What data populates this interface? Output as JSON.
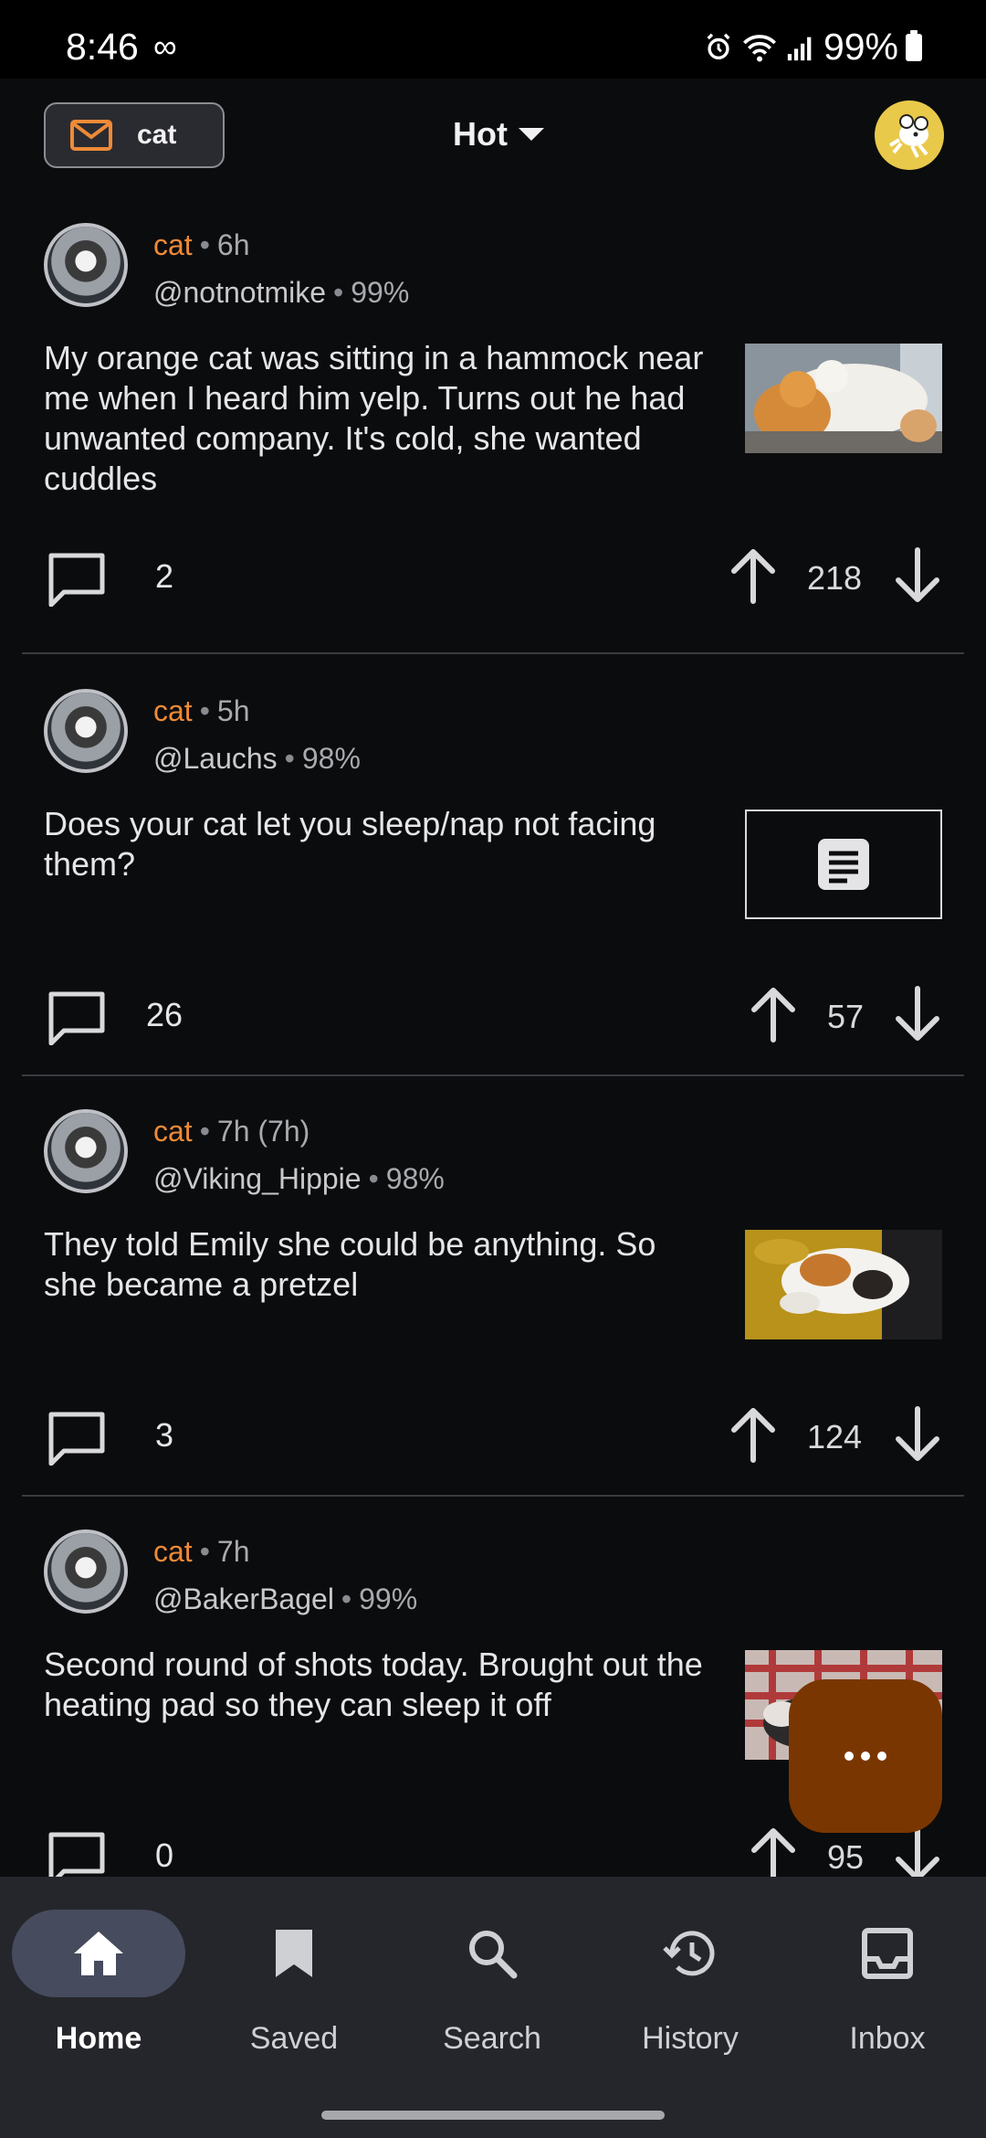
{
  "status_bar": {
    "time": "8:46",
    "infinity": "∞",
    "battery": "99%"
  },
  "top_bar": {
    "community_chip_label": "cat",
    "sort_label": "Hot"
  },
  "posts": [
    {
      "community": "cat",
      "time": "6h",
      "author": "@notnotmike",
      "upvote_ratio": "99%",
      "title": "My orange cat was sitting in a hammock near me when I heard him yelp. Turns out he had unwanted company. It's cold, she wanted cuddles",
      "comments": "2",
      "score": "218",
      "thumbnail": "photo"
    },
    {
      "community": "cat",
      "time": "5h",
      "author": "@Lauchs",
      "upvote_ratio": "98%",
      "title": "Does your cat let you sleep/nap not facing them?",
      "comments": "26",
      "score": "57",
      "thumbnail": "text-post-icon"
    },
    {
      "community": "cat",
      "time": "7h (7h)",
      "author": "@Viking_Hippie",
      "upvote_ratio": "98%",
      "title": "They told Emily she could be anything. So she became a pretzel",
      "comments": "3",
      "score": "124",
      "thumbnail": "photo"
    },
    {
      "community": "cat",
      "time": "7h",
      "author": "@BakerBagel",
      "upvote_ratio": "99%",
      "title": "Second round of shots today. Brought out the heating pad so they can sleep it off",
      "comments": "0",
      "score": "95",
      "thumbnail": "photo"
    }
  ],
  "fab_icon": "more-horizontal-icon",
  "bottom_nav": [
    {
      "label": "Home",
      "icon": "home-icon",
      "active": true
    },
    {
      "label": "Saved",
      "icon": "bookmark-icon",
      "active": false
    },
    {
      "label": "Search",
      "icon": "search-icon",
      "active": false
    },
    {
      "label": "History",
      "icon": "history-icon",
      "active": false
    },
    {
      "label": "Inbox",
      "icon": "inbox-icon",
      "active": false
    }
  ],
  "colors": {
    "accent": "#ee8a37",
    "background": "#0b0c0e",
    "fab": "#7a3600",
    "nav_bg": "#25262b",
    "nav_active_pill": "#464b5d"
  }
}
